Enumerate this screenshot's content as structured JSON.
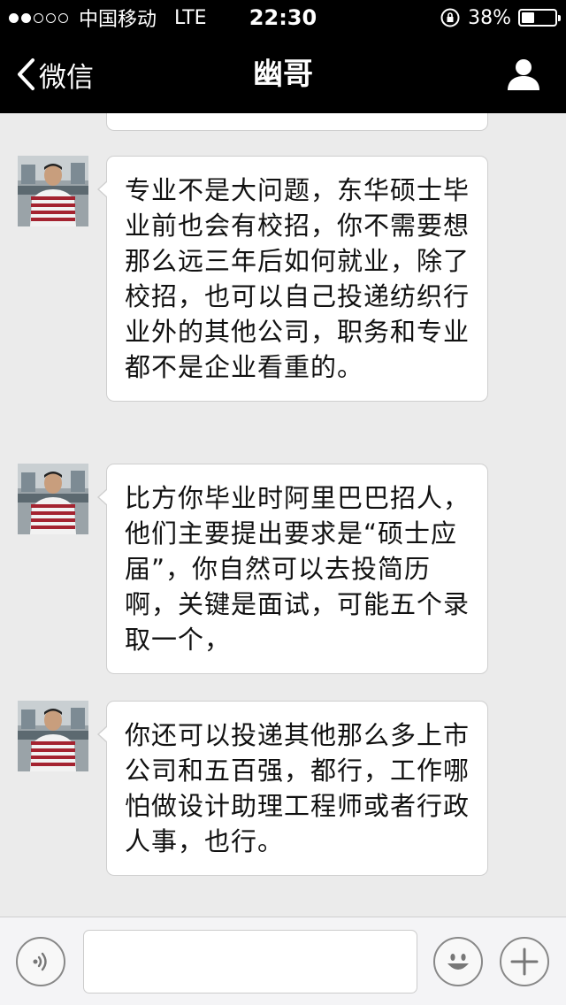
{
  "status_bar": {
    "carrier": "中国移动",
    "network": "LTE",
    "time": "22:30",
    "battery_percent": "38%",
    "battery_level": 0.38,
    "signal_bars_filled": 2,
    "signal_bars_total": 5
  },
  "nav": {
    "back_label": "微信",
    "title": "幽哥"
  },
  "messages": [
    {
      "sender": "幽哥",
      "text": "专业不是大问题，东华硕士毕业前也会有校招，你不需要想那么远三年后如何就业，除了校招，也可以自己投递纺织行业外的其他公司，职务和专业都不是企业看重的。"
    },
    {
      "sender": "幽哥",
      "text": "比方你毕业时阿里巴巴招人，他们主要提出要求是“硕士应届”，你自然可以去投简历啊，关键是面试，可能五个录取一个，"
    },
    {
      "sender": "幽哥",
      "text": "你还可以投递其他那么多上市公司和五百强，都行，工作哪怕做设计助理工程师或者行政人事，也行。"
    }
  ],
  "input": {
    "value": "",
    "placeholder": ""
  },
  "colors": {
    "bar_background": "#000000",
    "chat_background": "#ebebeb",
    "bubble_background": "#ffffff",
    "bubble_border": "#cfcfcf"
  },
  "icons": {
    "back": "chevron-left-icon",
    "profile": "person-icon",
    "voice": "voice-icon",
    "emoji": "emoji-icon",
    "plus": "plus-icon"
  }
}
